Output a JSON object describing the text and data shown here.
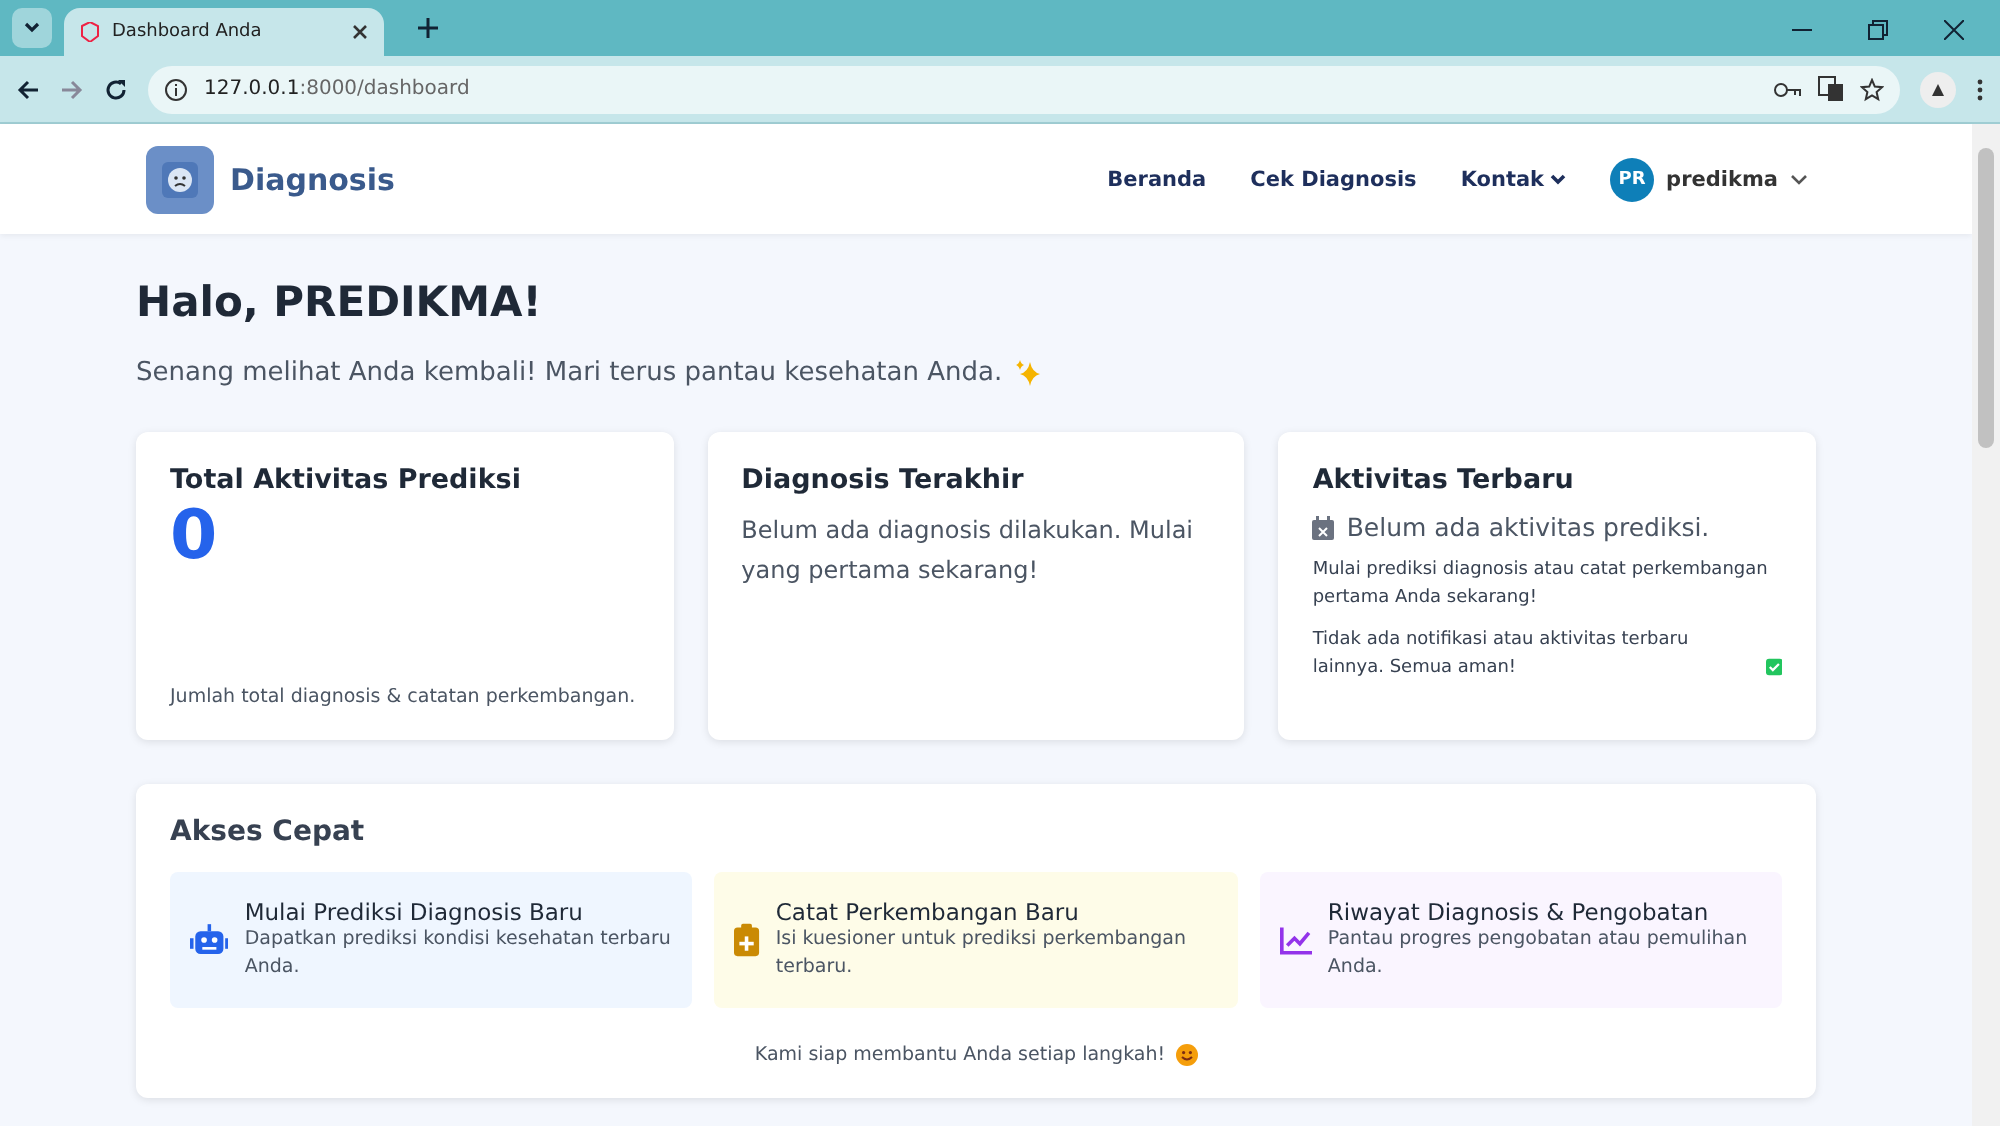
{
  "browser": {
    "tab_title": "Dashboard Anda",
    "url_host": "127.0.0.1",
    "url_rest": ":8000/dashboard"
  },
  "navbar": {
    "brand": "Diagnosis",
    "links": [
      {
        "label": "Beranda",
        "kind": "link"
      },
      {
        "label": "Cek Diagnosis",
        "kind": "link"
      },
      {
        "label": "Kontak",
        "kind": "dropdown"
      }
    ],
    "user": {
      "initials": "PR",
      "name": "predikma"
    }
  },
  "greeting": {
    "title": "Halo, PREDIKMA!",
    "subtitle": "Senang melihat Anda kembali! Mari terus pantau kesehatan Anda."
  },
  "stats": {
    "title": "Total Aktivitas Prediksi",
    "value": "0",
    "note": "Jumlah total diagnosis & catatan perkembangan."
  },
  "last_diagnosis": {
    "title": "Diagnosis Terakhir",
    "text": "Belum ada diagnosis dilakukan. Mulai yang pertama sekarang!"
  },
  "recent": {
    "title": "Aktivitas Terbaru",
    "empty": "Belum ada aktivitas prediksi.",
    "hint": "Mulai prediksi diagnosis atau catat perkembangan pertama Anda sekarang!",
    "note": "Tidak ada notifikasi atau aktivitas terbaru lainnya. Semua aman!"
  },
  "quick_access": {
    "title": "Akses Cepat",
    "items": [
      {
        "kind": "robot",
        "color": "#2563eb",
        "title": "Mulai Prediksi Diagnosis Baru",
        "desc": "Dapatkan prediksi kondisi kesehatan terbaru Anda."
      },
      {
        "kind": "clipboard",
        "color": "#ca8a04",
        "title": "Catat Perkembangan Baru",
        "desc": "Isi kuesioner untuk prediksi perkembangan terbaru."
      },
      {
        "kind": "chart",
        "color": "#9333ea",
        "title": "Riwayat Diagnosis & Pengobatan",
        "desc": "Pantau progres pengobatan atau pemulihan Anda."
      }
    ],
    "footer": "Kami siap membantu Anda setiap langkah!"
  }
}
